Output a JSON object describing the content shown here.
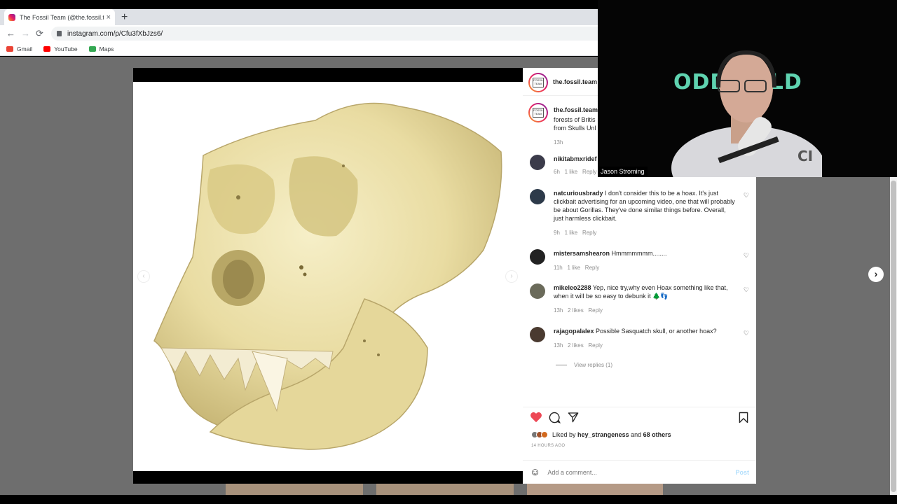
{
  "browser": {
    "tab_title": "The Fossil Team (@the.fossil.team",
    "tab_close": "×",
    "new_tab": "+",
    "back": "←",
    "forward": "→",
    "reload": "⟳",
    "url": "instagram.com/p/Cfu3fXbJzs6/",
    "bookmarks": [
      {
        "label": "Gmail",
        "color": "#ea4335"
      },
      {
        "label": "YouTube",
        "color": "#ff0000"
      },
      {
        "label": "Maps",
        "color": "#34a853"
      }
    ]
  },
  "post": {
    "header_username": "the.fossil.team",
    "caption_username": "the.fossil.team",
    "caption_line1": "forests of Britis",
    "caption_line2": "from Skulls Unl",
    "caption_time": "13h",
    "avatar_text": "FOSSIL TEAM",
    "comments": [
      {
        "user": "nikitabmxridef",
        "text": "",
        "time": "6h",
        "likes": "1 like",
        "reply": "Reply"
      },
      {
        "user": "natcuriousbrady",
        "text": "I don't consider this to be a hoax. It's just clickbait advertising for an upcoming video, one that will probably be about Gorillas. They've done similar things before. Overall, just harmless clickbait.",
        "time": "9h",
        "likes": "1 like",
        "reply": "Reply"
      },
      {
        "user": "mistersamshearon",
        "text": "Hmmmmmmm........",
        "time": "11h",
        "likes": "1 like",
        "reply": "Reply"
      },
      {
        "user": "mikeleo2288",
        "text": "Yep, nice try,why even Hoax something like that, when it will be so easy to debunk it 🌲👣",
        "time": "13h",
        "likes": "2 likes",
        "reply": "Reply"
      },
      {
        "user": "rajagopalalex",
        "text": "Possible Sasquatch skull, or another hoax?",
        "time": "13h",
        "likes": "2 likes",
        "reply": "Reply"
      }
    ],
    "view_replies": "View replies (1)",
    "liked_by_prefix": "Liked by",
    "liked_by_user": "hey_strangeness",
    "liked_by_and": "and",
    "liked_by_others": "68 others",
    "timestamp": "14 HOURS AGO",
    "add_comment_placeholder": "Add a comment...",
    "post_button": "Post"
  },
  "webcam": {
    "logo_text": "ODD TOLD",
    "name_label": "Jason Stroming"
  },
  "colors": {
    "heart_red": "#ed4956",
    "post_disabled": "#b2dffc",
    "logo_teal": "#5fd3b0"
  }
}
